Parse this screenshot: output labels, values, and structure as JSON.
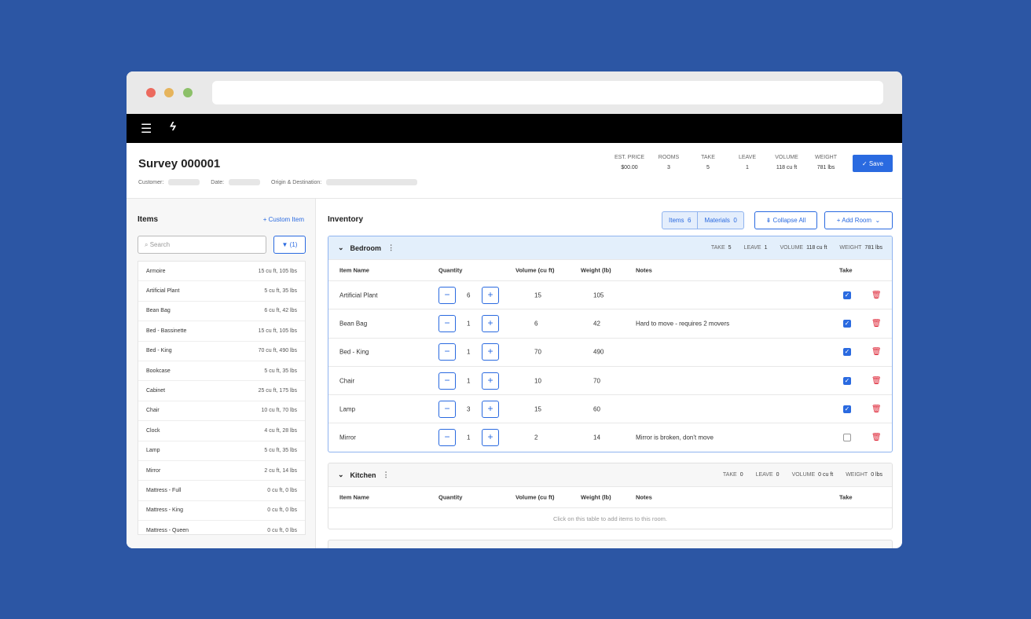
{
  "header": {
    "title": "Survey 000001",
    "customer_label": "Customer:",
    "date_label": "Date:",
    "origin_label": "Origin & Destination:",
    "stats": [
      {
        "label": "EST. PRICE",
        "value": "$00.00"
      },
      {
        "label": "ROOMS",
        "value": "3"
      },
      {
        "label": "TAKE",
        "value": "5"
      },
      {
        "label": "LEAVE",
        "value": "1"
      },
      {
        "label": "VOLUME",
        "value": "118 cu ft"
      },
      {
        "label": "WEIGHT",
        "value": "781 lbs"
      }
    ],
    "save_label": "✓ Save"
  },
  "items_panel": {
    "title": "Items",
    "custom_item": "+ Custom Item",
    "search_placeholder": "Search",
    "filter_label": "(1)",
    "items": [
      {
        "name": "Armoire",
        "spec": "15 cu ft, 105 lbs"
      },
      {
        "name": "Artificial Plant",
        "spec": "5 cu ft, 35 lbs"
      },
      {
        "name": "Bean Bag",
        "spec": "6 cu ft, 42 lbs"
      },
      {
        "name": "Bed - Bassinette",
        "spec": "15 cu ft, 105 lbs"
      },
      {
        "name": "Bed - King",
        "spec": "70 cu ft, 490 lbs"
      },
      {
        "name": "Bookcase",
        "spec": "5 cu ft, 35 lbs"
      },
      {
        "name": "Cabinet",
        "spec": "25 cu ft, 175 lbs"
      },
      {
        "name": "Chair",
        "spec": "10 cu ft, 70 lbs"
      },
      {
        "name": "Clock",
        "spec": "4 cu ft, 28 lbs"
      },
      {
        "name": "Lamp",
        "spec": "5 cu ft, 35 lbs"
      },
      {
        "name": "Mirror",
        "spec": "2 cu ft, 14 lbs"
      },
      {
        "name": "Mattress - Full",
        "spec": "0 cu ft, 0 lbs"
      },
      {
        "name": "Mattress - King",
        "spec": "0 cu ft, 0 lbs"
      },
      {
        "name": "Mattress - Queen",
        "spec": "0 cu ft, 0 lbs"
      }
    ]
  },
  "inventory": {
    "title": "Inventory",
    "items_tab": "Items  6",
    "materials_tab": "Materials  0",
    "collapse_all": "⇟ Collapse All",
    "add_room": "+ Add Room  ⌄",
    "columns": [
      "Item Name",
      "Quantity",
      "Volume (cu ft)",
      "Weight (lb)",
      "Notes",
      "Take"
    ],
    "rooms": [
      {
        "name": "Bedroom",
        "take": "5",
        "leave": "1",
        "volume": "118 cu ft",
        "weight": "781 lbs",
        "rows": [
          {
            "name": "Artificial Plant",
            "qty": "6",
            "vol": "15",
            "wt": "105",
            "notes": "",
            "take": true
          },
          {
            "name": "Bean Bag",
            "qty": "1",
            "vol": "6",
            "wt": "42",
            "notes": "Hard to move - requires 2 movers",
            "take": true
          },
          {
            "name": "Bed - King",
            "qty": "1",
            "vol": "70",
            "wt": "490",
            "notes": "",
            "take": true
          },
          {
            "name": "Chair",
            "qty": "1",
            "vol": "10",
            "wt": "70",
            "notes": "",
            "take": true
          },
          {
            "name": "Lamp",
            "qty": "3",
            "vol": "15",
            "wt": "60",
            "notes": "",
            "take": true
          },
          {
            "name": "Mirror",
            "qty": "1",
            "vol": "2",
            "wt": "14",
            "notes": "Mirror is broken, don't move",
            "take": false
          }
        ]
      },
      {
        "name": "Kitchen",
        "take": "0",
        "leave": "0",
        "volume": "0 cu ft",
        "weight": "0 lbs",
        "empty": "Click on this table to add items to this room."
      }
    ],
    "stat_labels": {
      "take": "TAKE",
      "leave": "LEAVE",
      "volume": "VOLUME",
      "weight": "WEIGHT"
    }
  }
}
